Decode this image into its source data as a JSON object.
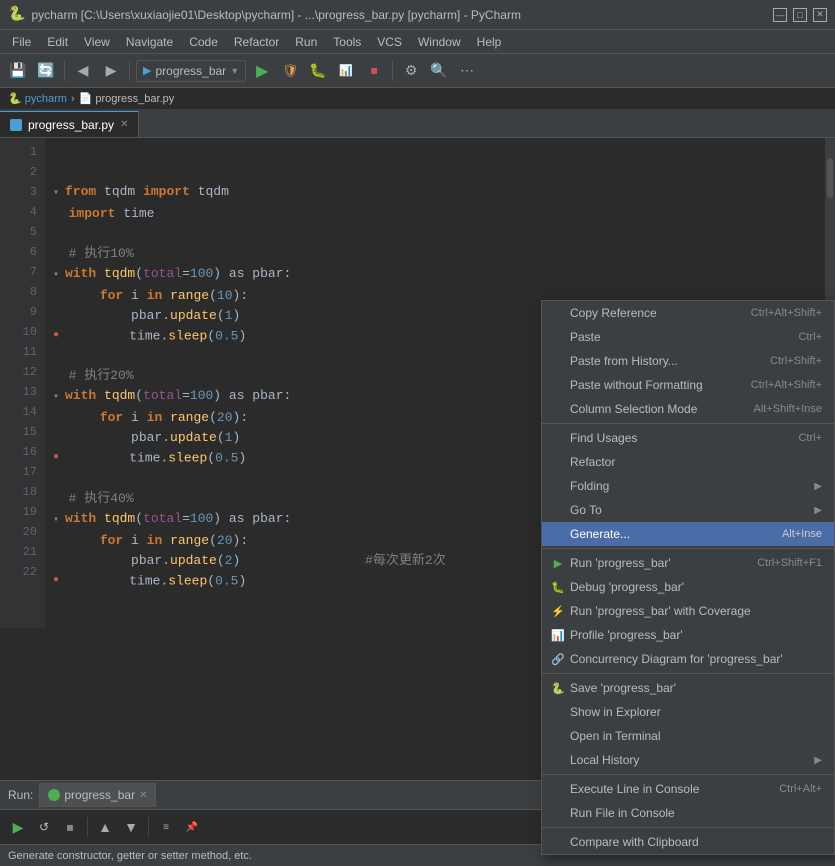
{
  "window": {
    "title": "pycharm [C:\\Users\\xuxiaojie01\\Desktop\\pycharm] - ...\\progress_bar.py [pycharm] - PyCharm",
    "icon": "🐍"
  },
  "title_controls": {
    "minimize": "—",
    "maximize": "□",
    "close": "✕"
  },
  "menu": {
    "items": [
      "File",
      "Edit",
      "View",
      "Navigate",
      "Code",
      "Refactor",
      "Run",
      "Tools",
      "VCS",
      "Window",
      "Help"
    ]
  },
  "breadcrumb": {
    "parts": [
      "pycharm",
      ">",
      "progress_bar.py"
    ]
  },
  "tab": {
    "name": "progress_bar.py",
    "close": "✕"
  },
  "code": {
    "lines": [
      {
        "num": "1",
        "content": ""
      },
      {
        "num": "2",
        "content": ""
      },
      {
        "num": "3",
        "content": "▾ from tqdm import tqdm"
      },
      {
        "num": "4",
        "content": "  import time"
      },
      {
        "num": "5",
        "content": ""
      },
      {
        "num": "6",
        "content": "  # 执行10%"
      },
      {
        "num": "7",
        "content": "▾ with tqdm(total=100) as pbar:"
      },
      {
        "num": "8",
        "content": "      for i in range(10):"
      },
      {
        "num": "9",
        "content": "          pbar.update(1)"
      },
      {
        "num": "10",
        "content": "●         time.sleep(0.5)"
      },
      {
        "num": "11",
        "content": ""
      },
      {
        "num": "12",
        "content": "  # 执行20%"
      },
      {
        "num": "13",
        "content": "▾ with tqdm(total=100) as pbar:"
      },
      {
        "num": "14",
        "content": "      for i in range(20):"
      },
      {
        "num": "15",
        "content": "          pbar.update(1)"
      },
      {
        "num": "16",
        "content": "●         time.sleep(0.5)"
      },
      {
        "num": "17",
        "content": ""
      },
      {
        "num": "18",
        "content": "  # 执行40%"
      },
      {
        "num": "19",
        "content": "▾ with tqdm(total=100) as pbar:"
      },
      {
        "num": "20",
        "content": "      for i in range(20):"
      },
      {
        "num": "21",
        "content": "          pbar.update(2)"
      },
      {
        "num": "22",
        "content": "●         time.sleep(0.5)"
      }
    ]
  },
  "context_menu": {
    "items": [
      {
        "label": "Copy Reference",
        "shortcut": "Ctrl+Alt+Shift+",
        "type": "item",
        "icon": ""
      },
      {
        "label": "Paste",
        "shortcut": "Ctrl+",
        "type": "item",
        "icon": ""
      },
      {
        "label": "Paste from History...",
        "shortcut": "Ctrl+Shift+",
        "type": "item",
        "icon": ""
      },
      {
        "label": "Paste without Formatting",
        "shortcut": "Ctrl+Alt+Shift+",
        "type": "item",
        "icon": ""
      },
      {
        "label": "Column Selection Mode",
        "shortcut": "Alt+Shift+Inse",
        "type": "item",
        "icon": ""
      },
      {
        "label": "",
        "shortcut": "",
        "type": "sep",
        "icon": ""
      },
      {
        "label": "Find Usages",
        "shortcut": "Ctrl+",
        "type": "item",
        "icon": ""
      },
      {
        "label": "Refactor",
        "shortcut": "",
        "type": "item",
        "icon": ""
      },
      {
        "label": "Folding",
        "shortcut": "",
        "type": "item",
        "icon": "",
        "arrow": "▶"
      },
      {
        "label": "Go To",
        "shortcut": "",
        "type": "item",
        "icon": "",
        "arrow": "▶"
      },
      {
        "label": "Generate...",
        "shortcut": "Alt+Inse",
        "type": "item",
        "icon": "",
        "highlighted": true
      },
      {
        "label": "",
        "shortcut": "",
        "type": "sep",
        "icon": ""
      },
      {
        "label": "Run 'progress_bar'",
        "shortcut": "Ctrl+Shift+F1",
        "type": "item",
        "icon": "▶"
      },
      {
        "label": "Debug 'progress_bar'",
        "shortcut": "",
        "type": "item",
        "icon": "🐛"
      },
      {
        "label": "Run 'progress_bar' with Coverage",
        "shortcut": "",
        "type": "item",
        "icon": "⚡"
      },
      {
        "label": "Profile 'progress_bar'",
        "shortcut": "",
        "type": "item",
        "icon": "📊"
      },
      {
        "label": "Concurrency Diagram for 'progress_bar'",
        "shortcut": "",
        "type": "item",
        "icon": "🔗"
      },
      {
        "label": "",
        "shortcut": "",
        "type": "sep",
        "icon": ""
      },
      {
        "label": "Save 'progress_bar'",
        "shortcut": "",
        "type": "item",
        "icon": "🐍"
      },
      {
        "label": "Show in Explorer",
        "shortcut": "",
        "type": "item",
        "icon": ""
      },
      {
        "label": "Open in Terminal",
        "shortcut": "",
        "type": "item",
        "icon": ""
      },
      {
        "label": "Local History",
        "shortcut": "",
        "type": "item",
        "icon": "",
        "arrow": "▶"
      },
      {
        "label": "",
        "shortcut": "",
        "type": "sep",
        "icon": ""
      },
      {
        "label": "Execute Line in Console",
        "shortcut": "Ctrl+Alt+",
        "type": "item",
        "icon": ""
      },
      {
        "label": "Run File in Console",
        "shortcut": "",
        "type": "item",
        "icon": ""
      },
      {
        "label": "",
        "shortcut": "",
        "type": "sep",
        "icon": ""
      },
      {
        "label": "Compare with Clipboard",
        "shortcut": "",
        "type": "item",
        "icon": ""
      }
    ]
  },
  "run_bar": {
    "label": "Run:",
    "tab": "progress_bar",
    "close": "✕"
  },
  "status_bar": {
    "text": "Generate constructor, getter or setter method, etc."
  },
  "annotation": "#每次更新2次"
}
